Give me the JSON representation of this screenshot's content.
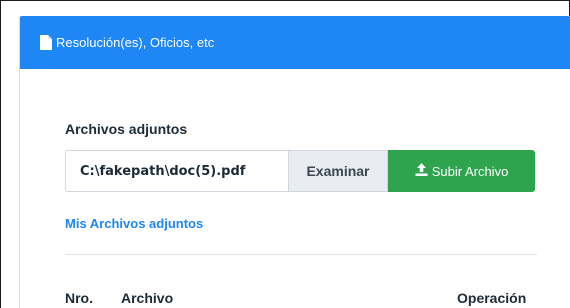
{
  "panel": {
    "title": "Resolución(es), Oficios, etc",
    "header_color": "#1f86f5"
  },
  "attachments": {
    "section_label": "Archivos adjuntos",
    "file_value": "C:\\fakepath\\doc(5).pdf",
    "browse_label": "Examinar",
    "upload_label": "Subir Archivo",
    "upload_color": "#2ea44f",
    "my_files_link": "Mis Archivos adjuntos"
  },
  "table": {
    "headers": [
      "Nro.",
      "Archivo",
      "Operación"
    ]
  },
  "icons": {
    "header_icon": "document-icon",
    "upload_icon": "upload-icon"
  }
}
